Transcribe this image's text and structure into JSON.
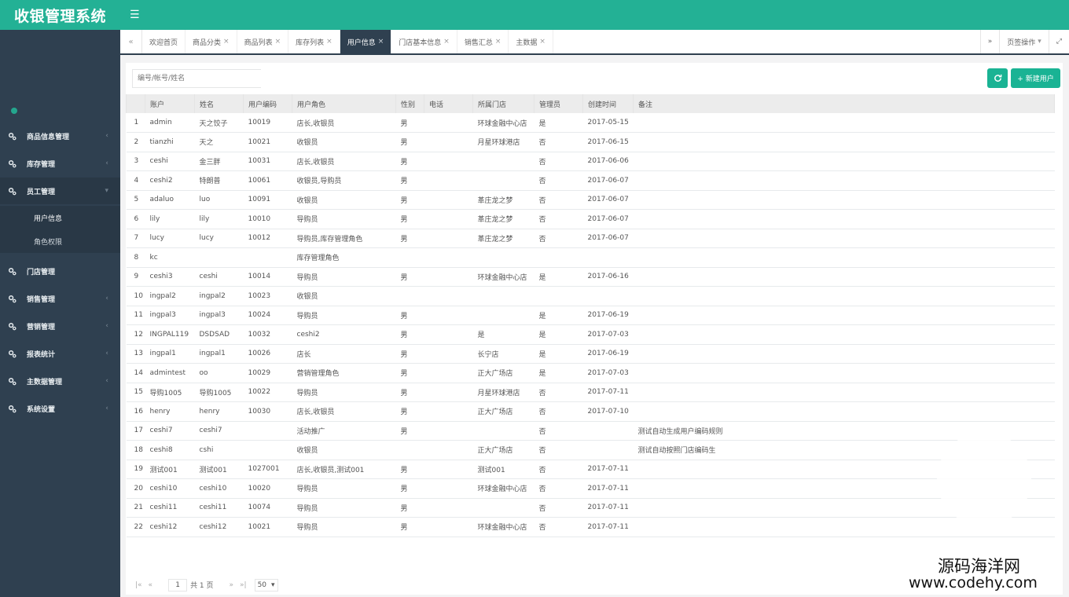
{
  "app": {
    "title": "收银管理系统",
    "menu_icon": "hamburger-icon"
  },
  "sidebar": {
    "items": [
      {
        "label": "商品信息管理",
        "has_arrow": true
      },
      {
        "label": "库存管理",
        "has_arrow": true
      },
      {
        "label": "员工管理",
        "has_arrow": true,
        "open": true,
        "children": [
          {
            "label": "用户信息",
            "active": true
          },
          {
            "label": "角色权限"
          }
        ]
      },
      {
        "label": "门店管理",
        "has_arrow": false
      },
      {
        "label": "销售管理",
        "has_arrow": true
      },
      {
        "label": "营销管理",
        "has_arrow": true
      },
      {
        "label": "报表统计",
        "has_arrow": true
      },
      {
        "label": "主数据管理",
        "has_arrow": true
      },
      {
        "label": "系统设置",
        "has_arrow": true
      }
    ]
  },
  "tabs": {
    "prev": "«",
    "next": "»",
    "items": [
      {
        "label": "欢迎首页",
        "closable": false
      },
      {
        "label": "商品分类",
        "closable": true
      },
      {
        "label": "商品列表",
        "closable": true
      },
      {
        "label": "库存列表",
        "closable": true
      },
      {
        "label": "用户信息",
        "closable": true,
        "active": true
      },
      {
        "label": "门店基本信息",
        "closable": true
      },
      {
        "label": "销售汇总",
        "closable": true
      },
      {
        "label": "主数据",
        "closable": true
      }
    ],
    "page_ops": "页签操作",
    "close_icon": "×"
  },
  "toolbar": {
    "search_placeholder": "编号/帐号/姓名",
    "new_user": "+ 新建用户"
  },
  "table": {
    "columns": [
      "",
      "账户",
      "姓名",
      "用户编码",
      "用户角色",
      "性别",
      "电话",
      "所属门店",
      "管理员",
      "创建时间",
      "备注"
    ],
    "rows": [
      [
        "1",
        "admin",
        "天之饺子",
        "10019",
        "店长,收银员",
        "男",
        "",
        "环球金融中心店",
        "是",
        "2017-05-15",
        ""
      ],
      [
        "2",
        "tianzhi",
        "天之",
        "10021",
        "收银员",
        "男",
        "",
        "月星环球港店",
        "否",
        "2017-06-15",
        ""
      ],
      [
        "3",
        "ceshi",
        "金三胖",
        "10031",
        "店长,收银员",
        "男",
        "",
        "",
        "否",
        "2017-06-06",
        ""
      ],
      [
        "4",
        "ceshi2",
        "特朗普",
        "10061",
        "收银员,导购员",
        "男",
        "",
        "",
        "否",
        "2017-06-07",
        ""
      ],
      [
        "5",
        "adaluo",
        "luo",
        "10091",
        "收银员",
        "男",
        "",
        "革庄龙之梦",
        "否",
        "2017-06-07",
        ""
      ],
      [
        "6",
        "lily",
        "lily",
        "10010",
        "导购员",
        "男",
        "",
        "革庄龙之梦",
        "否",
        "2017-06-07",
        ""
      ],
      [
        "7",
        "lucy",
        "lucy",
        "10012",
        "导购员,库存管理角色",
        "男",
        "",
        "革庄龙之梦",
        "否",
        "2017-06-07",
        ""
      ],
      [
        "8",
        "kc",
        "",
        "",
        "库存管理角色",
        "",
        "",
        "",
        "",
        "",
        ""
      ],
      [
        "9",
        "ceshi3",
        "ceshi",
        "10014",
        "导购员",
        "男",
        "",
        "环球金融中心店",
        "是",
        "2017-06-16",
        ""
      ],
      [
        "10",
        "ingpal2",
        "ingpal2",
        "10023",
        "收银员",
        "",
        "",
        "",
        "",
        "",
        ""
      ],
      [
        "11",
        "ingpal3",
        "ingpal3",
        "10024",
        "导购员",
        "男",
        "",
        "",
        "是",
        "2017-06-19",
        ""
      ],
      [
        "12",
        "INGPAL119",
        "DSDSAD",
        "10032",
        "ceshi2",
        "男",
        "",
        "是",
        "是",
        "2017-07-03",
        ""
      ],
      [
        "13",
        "ingpal1",
        "ingpal1",
        "10026",
        "店长",
        "男",
        "",
        "长宁店",
        "是",
        "2017-06-19",
        ""
      ],
      [
        "14",
        "admintest",
        "oo",
        "10029",
        "营销管理角色",
        "男",
        "",
        "正大广场店",
        "是",
        "2017-07-03",
        ""
      ],
      [
        "15",
        "导购1005",
        "导购1005",
        "10022",
        "导购员",
        "男",
        "",
        "月星环球港店",
        "否",
        "2017-07-11",
        ""
      ],
      [
        "16",
        "henry",
        "henry",
        "10030",
        "店长,收银员",
        "男",
        "",
        "正大广场店",
        "否",
        "2017-07-10",
        ""
      ],
      [
        "17",
        "ceshi7",
        "ceshi7",
        "",
        "活动推广",
        "男",
        "",
        "",
        "否",
        "",
        "测试自动生成用户编码规则"
      ],
      [
        "18",
        "ceshi8",
        "cshi",
        "",
        "收银员",
        "",
        "",
        "正大广场店",
        "否",
        "",
        "测试自动按照门店编码生"
      ],
      [
        "19",
        "测试001",
        "测试001",
        "1027001",
        "店长,收银员,测试001",
        "男",
        "",
        "测试001",
        "否",
        "2017-07-11",
        ""
      ],
      [
        "20",
        "ceshi10",
        "ceshi10",
        "10020",
        "导购员",
        "男",
        "",
        "环球金融中心店",
        "否",
        "2017-07-11",
        ""
      ],
      [
        "21",
        "ceshi11",
        "ceshi11",
        "10074",
        "导购员",
        "男",
        "",
        "",
        "否",
        "2017-07-11",
        ""
      ],
      [
        "22",
        "ceshi12",
        "ceshi12",
        "10021",
        "导购员",
        "男",
        "",
        "环球金融中心店",
        "否",
        "2017-07-11",
        ""
      ]
    ]
  },
  "pager": {
    "first": "|«",
    "prev": "«",
    "page": "1",
    "total": "共 1 页",
    "next": "»",
    "last": "»|",
    "size": "50"
  },
  "watermark": {
    "line1": "源码海洋网",
    "line2": "www.codehy.com"
  },
  "colors": {
    "brand": "#23b195",
    "sidebar": "#2f4050",
    "button": "#1ab394"
  }
}
